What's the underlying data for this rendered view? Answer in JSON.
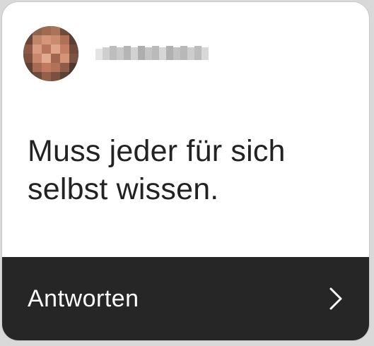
{
  "user": {
    "username": "",
    "avatar_icon": "user-avatar-pixelated"
  },
  "message": {
    "text": "Muss jeder für sich selbst wissen."
  },
  "reply": {
    "label": "Antworten",
    "icon": "chevron-right-icon"
  },
  "colors": {
    "card_bg": "#ffffff",
    "bar_bg": "#262626",
    "text": "#222222",
    "bar_text": "#ffffff"
  }
}
